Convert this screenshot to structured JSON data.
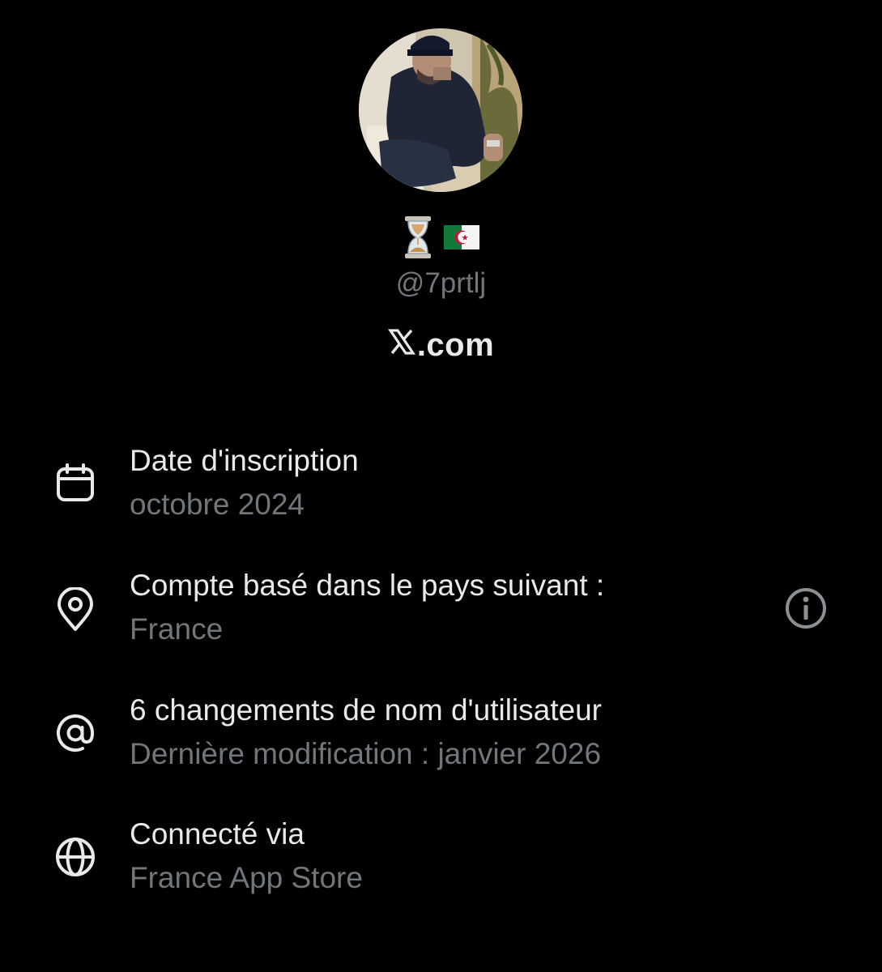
{
  "profile": {
    "avatar_alt": "avatar",
    "emojis": [
      "hourglass",
      "algeria-flag"
    ],
    "handle": "@7prtlj",
    "site_text": ".com"
  },
  "colors": {
    "background": "#000000",
    "primary_text": "#e7e9ea",
    "secondary_text": "#71767b"
  },
  "details": [
    {
      "icon": "calendar-icon",
      "title": "Date d'inscription",
      "subtitle": "octobre 2024"
    },
    {
      "icon": "location-pin-icon",
      "title": "Compte basé dans le pays suivant :",
      "subtitle": "France"
    },
    {
      "icon": "at-sign-icon",
      "title": "6 changements de nom d'utilisateur",
      "subtitle": "Dernière modification : janvier 2026"
    },
    {
      "icon": "globe-icon",
      "title": "Connecté via",
      "subtitle": "France App Store"
    }
  ]
}
